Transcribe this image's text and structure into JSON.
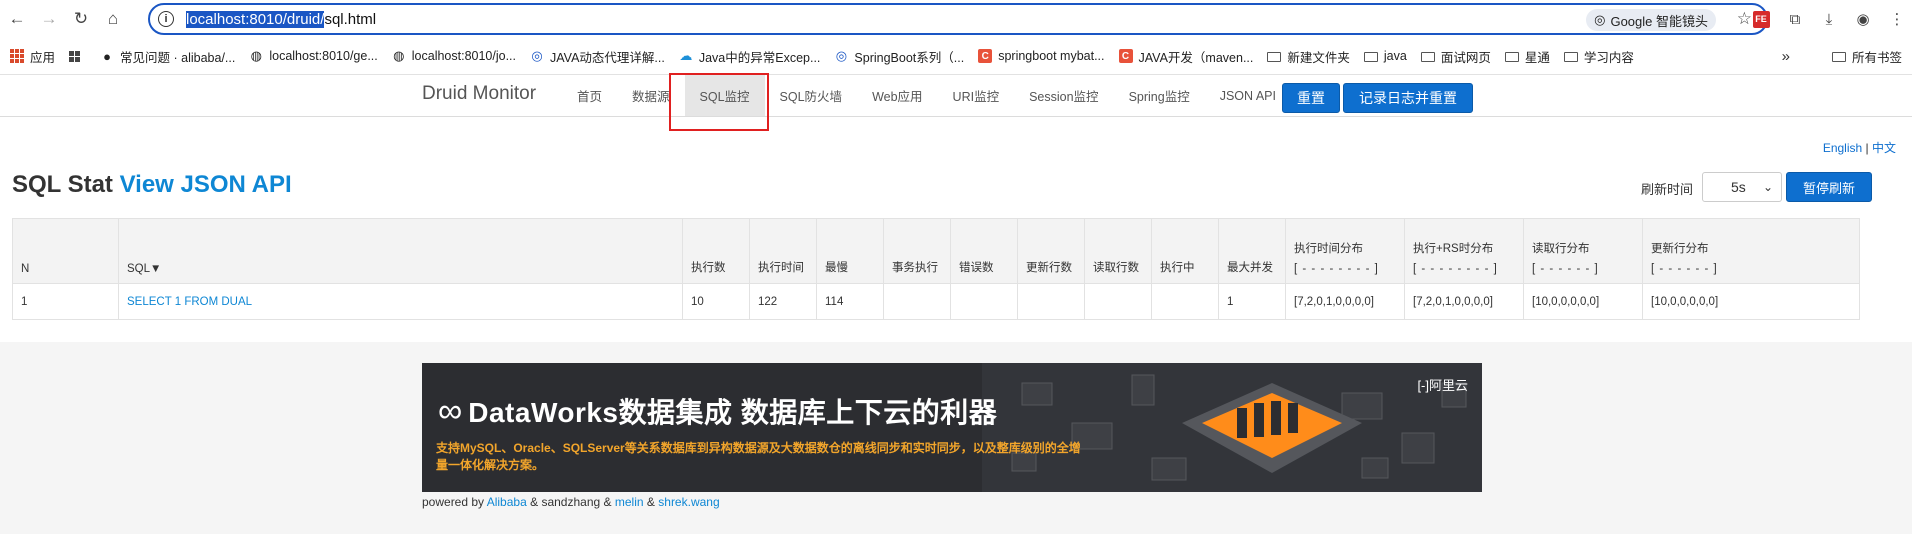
{
  "browser": {
    "url_selected": "localhost:8010/druid/",
    "url_rest": "sql.html",
    "lens_label": "Google 智能镜头"
  },
  "bookmarks": [
    {
      "label": "应用",
      "icon": "apps-grid-icon"
    },
    {
      "label": "",
      "icon": "tab-grid-icon"
    },
    {
      "label": "常见问题 · alibaba/...",
      "icon": "github-icon"
    },
    {
      "label": "localhost:8010/ge...",
      "icon": "globe-icon"
    },
    {
      "label": "localhost:8010/jo...",
      "icon": "globe-icon"
    },
    {
      "label": "JAVA动态代理详解...",
      "icon": "blog-icon"
    },
    {
      "label": "Java中的异常Excep...",
      "icon": "cloud-icon"
    },
    {
      "label": "SpringBoot系列（...",
      "icon": "blog-icon"
    },
    {
      "label": "springboot mybat...",
      "icon": "csdn-icon"
    },
    {
      "label": "JAVA开发（maven...",
      "icon": "csdn-icon"
    },
    {
      "label": "新建文件夹",
      "icon": "folder-icon"
    },
    {
      "label": "java",
      "icon": "folder-icon"
    },
    {
      "label": "面试网页",
      "icon": "folder-icon"
    },
    {
      "label": "星通",
      "icon": "folder-icon"
    },
    {
      "label": "学习内容",
      "icon": "folder-icon"
    }
  ],
  "bookmarks_all": "所有书签",
  "druid": {
    "brand": "Druid Monitor",
    "menu": [
      "首页",
      "数据源",
      "SQL监控",
      "SQL防火墙",
      "Web应用",
      "URI监控",
      "Session监控",
      "Spring监控",
      "JSON API"
    ],
    "active_menu": "SQL监控",
    "reset_label": "重置",
    "log_reset_label": "记录日志并重置",
    "lang_en": "English",
    "lang_sep": "|",
    "lang_zh": "中文",
    "title_main": "SQL Stat",
    "title_link": "View JSON API",
    "refresh_label": "刷新时间",
    "refresh_value": "5s",
    "pause_label": "暂停刷新"
  },
  "table": {
    "headers": [
      {
        "label": "N",
        "sub": ""
      },
      {
        "label": "SQL▼",
        "sub": ""
      },
      {
        "label": "执行数",
        "sub": ""
      },
      {
        "label": "执行时间",
        "sub": ""
      },
      {
        "label": "最慢",
        "sub": ""
      },
      {
        "label": "事务执行",
        "sub": ""
      },
      {
        "label": "错误数",
        "sub": ""
      },
      {
        "label": "更新行数",
        "sub": ""
      },
      {
        "label": "读取行数",
        "sub": ""
      },
      {
        "label": "执行中",
        "sub": ""
      },
      {
        "label": "最大并发",
        "sub": ""
      },
      {
        "label": "执行时间分布",
        "sub": "[ - - - - - - - - ]"
      },
      {
        "label": "执行+RS时分布",
        "sub": "[ - - - - - - - - ]"
      },
      {
        "label": "读取行分布",
        "sub": "[ - - - - - - ]"
      },
      {
        "label": "更新行分布",
        "sub": "[ - - - - - - ]"
      }
    ],
    "rows": [
      [
        "1",
        "SELECT 1 FROM DUAL",
        "10",
        "122",
        "114",
        "",
        "",
        "",
        "",
        "",
        "1",
        "[7,2,0,1,0,0,0,0]",
        "[7,2,0,1,0,0,0,0]",
        "[10,0,0,0,0,0]",
        "[10,0,0,0,0,0]"
      ]
    ]
  },
  "banner": {
    "title": "DataWorks数据集成 数据库上下云的利器",
    "subtitle": "支持MySQL、Oracle、SQLServer等关系数据库到异构数据源及大数据数仓的离线同步和实时同步，以及整库级别的全增量一体化解决方案。",
    "aliyun": "[-]阿里云"
  },
  "footer": {
    "powered_by": "powered by",
    "alibaba": "Alibaba",
    "amp1": "&",
    "sandzhang": "sandzhang",
    "amp2": "&",
    "melin": "melin",
    "amp3": "&",
    "shrek": "shrek.wang"
  }
}
